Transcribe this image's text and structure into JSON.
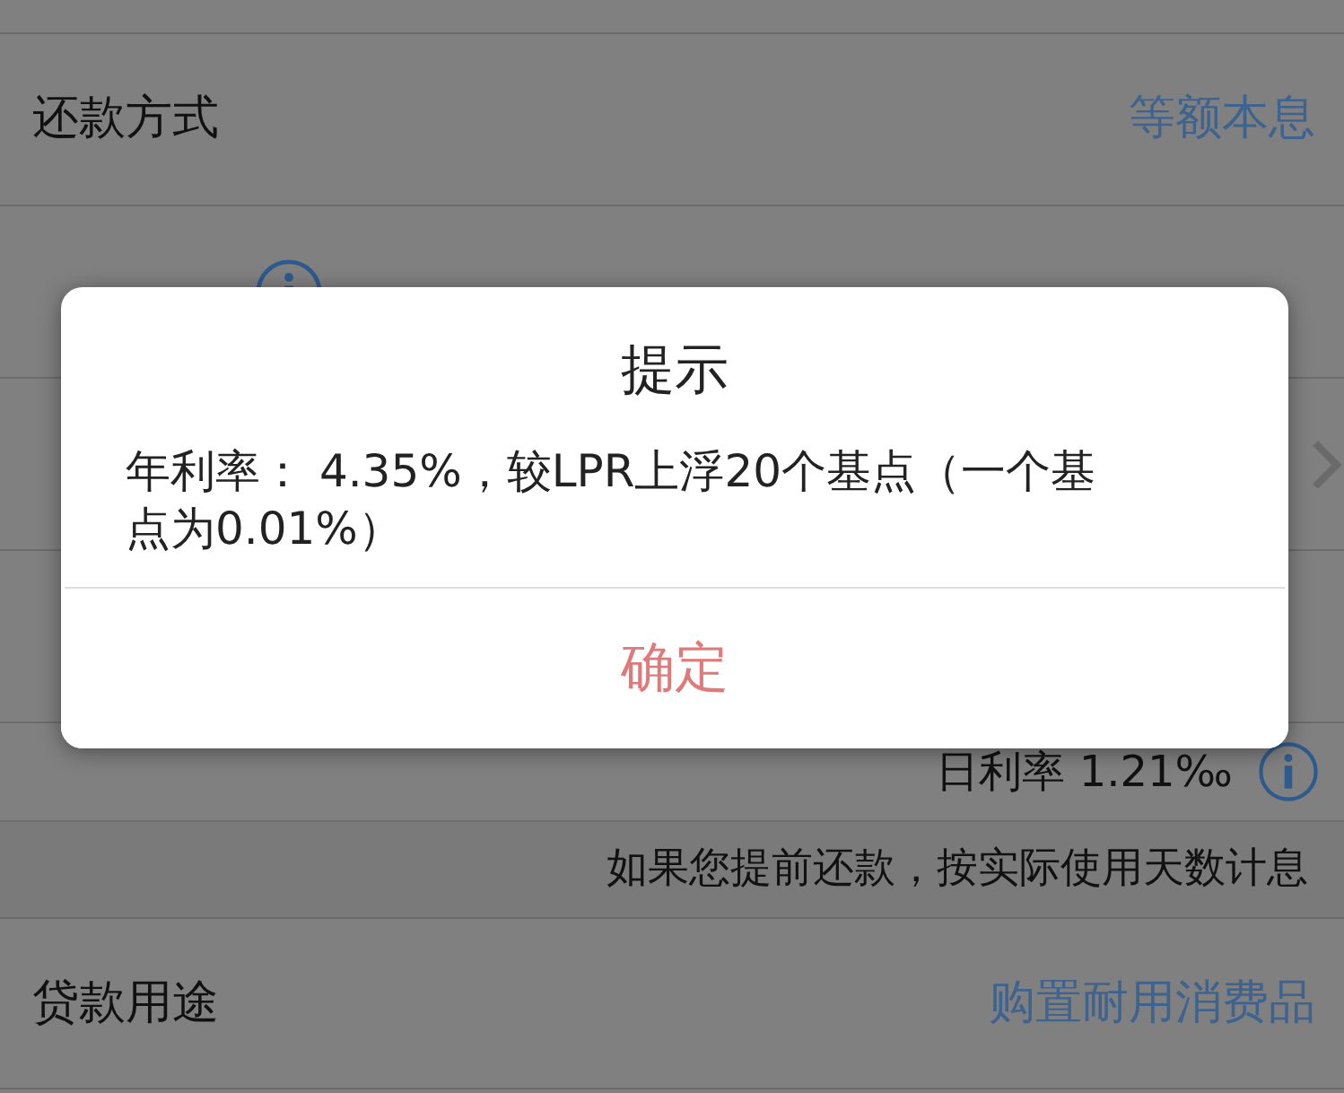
{
  "rows": [
    {
      "kind": "field",
      "label": "还款方式",
      "value": "等额本息"
    },
    {
      "kind": "field",
      "info": true
    },
    {
      "kind": "link"
    },
    {
      "kind": "field"
    },
    {
      "kind": "rate",
      "value": "日利率 1.21‰",
      "info": true
    },
    {
      "kind": "note",
      "value": "如果您提前还款，按实际使用天数计息"
    },
    {
      "kind": "field",
      "label": "贷款用途",
      "value": "购置耐用消费品"
    }
  ],
  "dialog": {
    "title": "提示",
    "message": "年利率： 4.35%，较LPR上浮20个基点（一个基点为0.01%）",
    "button": "确定"
  }
}
